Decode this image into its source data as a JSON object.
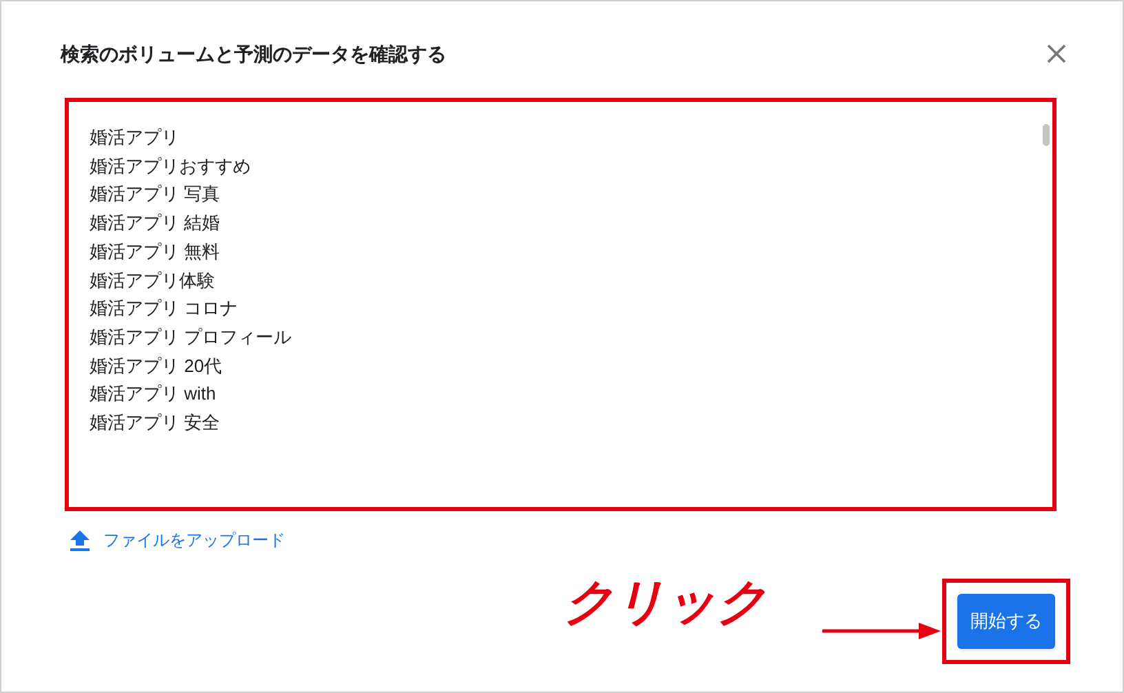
{
  "dialog": {
    "title": "検索のボリュームと予測のデータを確認する"
  },
  "keywords": [
    "婚活アプリ",
    "婚活アプリおすすめ",
    "婚活アプリ 写真",
    "婚活アプリ 結婚",
    "婚活アプリ 無料",
    "婚活アプリ体験",
    "婚活アプリ コロナ",
    "婚活アプリ プロフィール",
    "婚活アプリ 20代",
    "婚活アプリ with",
    "婚活アプリ 安全"
  ],
  "upload_link": "ファイルをアップロード",
  "start_button": "開始する",
  "annotation": {
    "text": "クリック"
  }
}
